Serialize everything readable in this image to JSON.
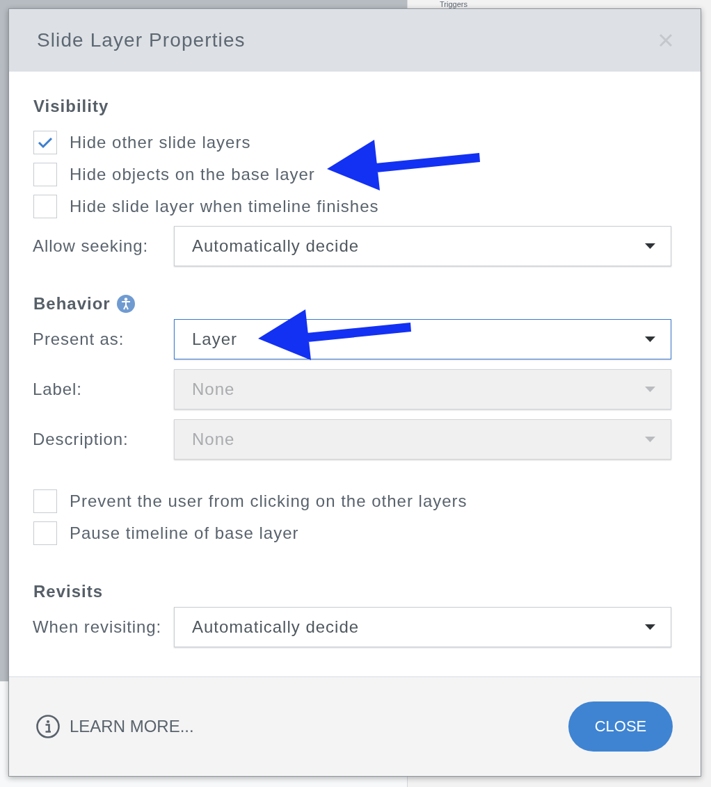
{
  "backdrop": {
    "panel_title": "Triggers"
  },
  "dialog": {
    "title": "Slide Layer Properties",
    "sections": [
      {
        "heading": "Visibility",
        "help_icon": false,
        "items": [
          {
            "kind": "checkbox",
            "label": "Hide other slide layers",
            "checked": true,
            "arrow": false
          },
          {
            "kind": "checkbox",
            "label": "Hide objects on the base layer",
            "checked": false,
            "arrow": true
          },
          {
            "kind": "checkbox",
            "label": "Hide slide layer when timeline finishes",
            "checked": false,
            "arrow": false
          },
          {
            "kind": "dropdown",
            "label": "Allow seeking:",
            "value": "Automatically decide",
            "focused": false,
            "disabled": false,
            "arrow": false
          }
        ]
      },
      {
        "heading": "Behavior",
        "help_icon": true,
        "items": [
          {
            "kind": "dropdown",
            "label": "Present as:",
            "value": "Layer",
            "focused": true,
            "disabled": false,
            "arrow": true
          },
          {
            "kind": "dropdown",
            "label": "Label:",
            "value": "None",
            "focused": false,
            "disabled": true,
            "arrow": false
          },
          {
            "kind": "dropdown",
            "label": "Description:",
            "value": "None",
            "focused": false,
            "disabled": true,
            "arrow": false
          },
          {
            "kind": "checkbox",
            "label": "Prevent the user from clicking on the other layers",
            "checked": false,
            "arrow": false
          },
          {
            "kind": "checkbox",
            "label": "Pause timeline of base layer",
            "checked": false,
            "arrow": false
          }
        ]
      },
      {
        "heading": "Revisits",
        "help_icon": false,
        "items": [
          {
            "kind": "dropdown",
            "label": "When revisiting:",
            "value": "Automatically decide",
            "focused": false,
            "disabled": false,
            "arrow": false
          }
        ]
      }
    ],
    "footer": {
      "link": "LEARN MORE...",
      "button": "CLOSE"
    }
  }
}
